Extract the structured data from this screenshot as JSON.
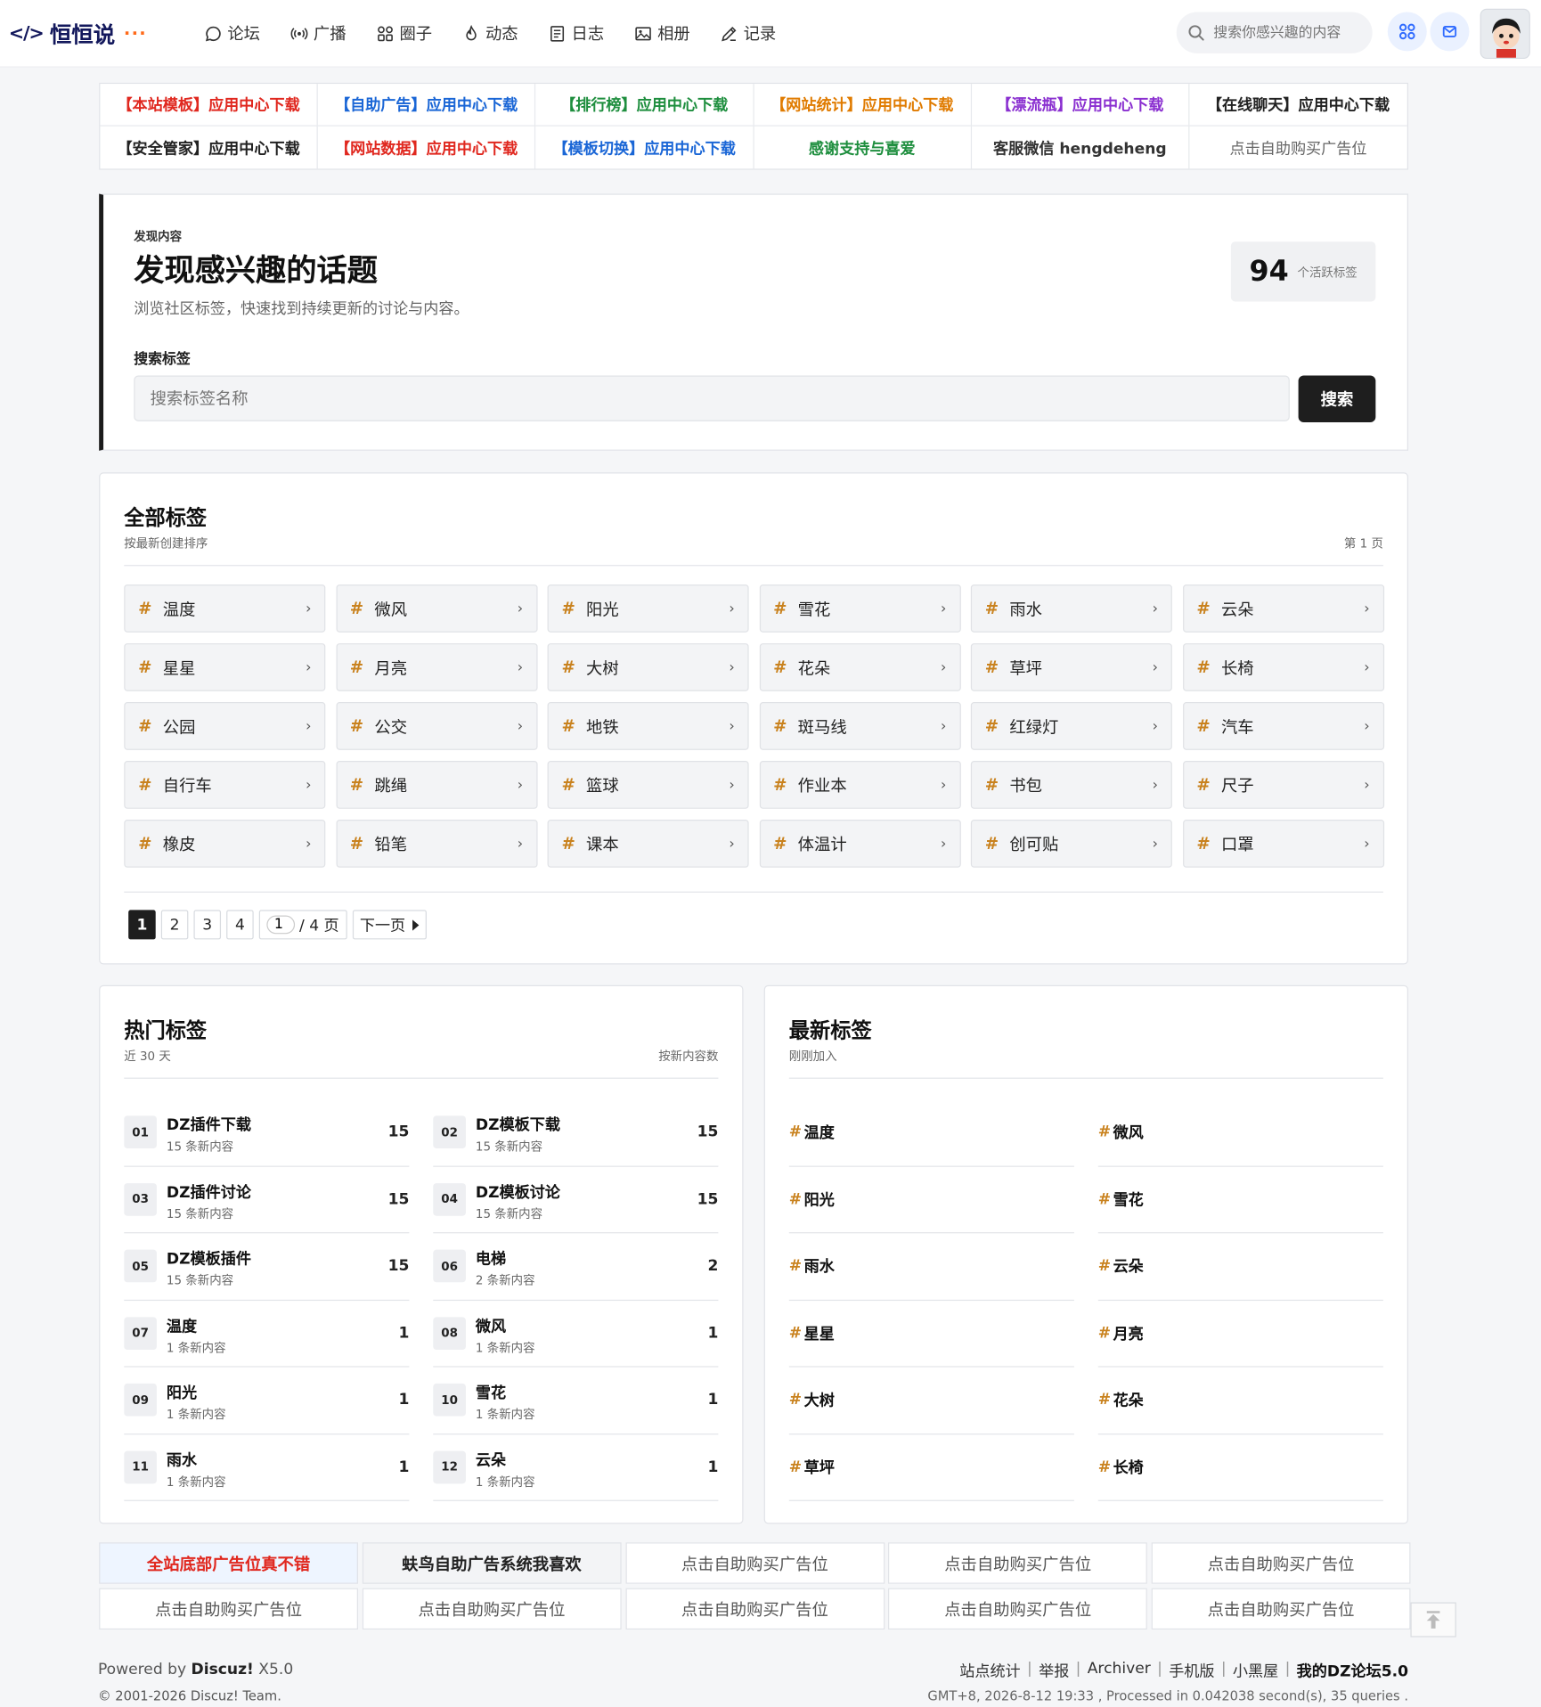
{
  "header": {
    "logo_text": "恒恒说",
    "logo_code": "</>",
    "logo_dots": "···",
    "nav": [
      {
        "label": "论坛",
        "icon": "chat-bubble-icon"
      },
      {
        "label": "广播",
        "icon": "broadcast-icon"
      },
      {
        "label": "圈子",
        "icon": "grid-icon"
      },
      {
        "label": "动态",
        "icon": "flame-icon"
      },
      {
        "label": "日志",
        "icon": "document-icon"
      },
      {
        "label": "相册",
        "icon": "image-icon"
      },
      {
        "label": "记录",
        "icon": "pen-icon"
      }
    ],
    "search_placeholder": "搜索你感兴趣的内容"
  },
  "top_ads": [
    {
      "text": "【本站模板】应用中心下载",
      "color": "#e0281f"
    },
    {
      "text": "【自助广告】应用中心下载",
      "color": "#1a66d6"
    },
    {
      "text": "【排行榜】应用中心下载",
      "color": "#1e8e3e"
    },
    {
      "text": "【网站统计】应用中心下载",
      "color": "#e07b00"
    },
    {
      "text": "【漂流瓶】应用中心下载",
      "color": "#8a2fd0"
    },
    {
      "text": "【在线聊天】应用中心下载",
      "color": "#222222"
    },
    {
      "text": "【安全管家】应用中心下载",
      "color": "#222222"
    },
    {
      "text": "【网站数据】应用中心下载",
      "color": "#e0281f"
    },
    {
      "text": "【模板切换】应用中心下载",
      "color": "#1a66d6"
    },
    {
      "text": "感谢支持与喜爱",
      "color": "#1e8e3e"
    },
    {
      "text": "客服微信 hengdeheng",
      "color": "#333333"
    },
    {
      "text": "点击自助购买广告位",
      "color": "#666666",
      "weight": "normal"
    }
  ],
  "discover": {
    "eyebrow": "发现内容",
    "title": "发现感兴趣的话题",
    "desc": "浏览社区标签，快速找到持续更新的讨论与内容。",
    "stat_num": "94",
    "stat_label": "个活跃标签",
    "search_label": "搜索标签",
    "search_placeholder": "搜索标签名称",
    "search_button": "搜索"
  },
  "all_tags": {
    "title": "全部标签",
    "subtitle": "按最新创建排序",
    "page_label": "第 1 页",
    "hash": "#",
    "chevron": "›",
    "tags": [
      "温度",
      "微风",
      "阳光",
      "雪花",
      "雨水",
      "云朵",
      "星星",
      "月亮",
      "大树",
      "花朵",
      "草坪",
      "长椅",
      "公园",
      "公交",
      "地铁",
      "斑马线",
      "红绿灯",
      "汽车",
      "自行车",
      "跳绳",
      "篮球",
      "作业本",
      "书包",
      "尺子",
      "橡皮",
      "铅笔",
      "课本",
      "体温计",
      "创可贴",
      "口罩"
    ],
    "pager": {
      "pages": [
        "1",
        "2",
        "3",
        "4"
      ],
      "input_value": "1",
      "total": "/ 4 页",
      "next": "下一页"
    }
  },
  "hot_tags": {
    "title": "热门标签",
    "subtitle": "近 30 天",
    "right": "按新内容数",
    "items": [
      {
        "rank": "01",
        "name": "DZ插件下载",
        "count": "15 条新内容",
        "value": "15"
      },
      {
        "rank": "02",
        "name": "DZ模板下载",
        "count": "15 条新内容",
        "value": "15"
      },
      {
        "rank": "03",
        "name": "DZ插件讨论",
        "count": "15 条新内容",
        "value": "15"
      },
      {
        "rank": "04",
        "name": "DZ模板讨论",
        "count": "15 条新内容",
        "value": "15"
      },
      {
        "rank": "05",
        "name": "DZ模板插件",
        "count": "15 条新内容",
        "value": "15"
      },
      {
        "rank": "06",
        "name": "电梯",
        "count": "2 条新内容",
        "value": "2"
      },
      {
        "rank": "07",
        "name": "温度",
        "count": "1 条新内容",
        "value": "1"
      },
      {
        "rank": "08",
        "name": "微风",
        "count": "1 条新内容",
        "value": "1"
      },
      {
        "rank": "09",
        "name": "阳光",
        "count": "1 条新内容",
        "value": "1"
      },
      {
        "rank": "10",
        "name": "雪花",
        "count": "1 条新内容",
        "value": "1"
      },
      {
        "rank": "11",
        "name": "雨水",
        "count": "1 条新内容",
        "value": "1"
      },
      {
        "rank": "12",
        "name": "云朵",
        "count": "1 条新内容",
        "value": "1"
      }
    ]
  },
  "new_tags": {
    "title": "最新标签",
    "subtitle": "刚刚加入",
    "items": [
      "温度",
      "微风",
      "阳光",
      "雪花",
      "雨水",
      "云朵",
      "星星",
      "月亮",
      "大树",
      "花朵",
      "草坪",
      "长椅"
    ]
  },
  "bottom_ads": [
    {
      "text": "全站底部广告位真不错",
      "color": "#e0281f",
      "bg": "#eef5ff",
      "weight": "bold"
    },
    {
      "text": "蚨鸟自助广告系统我喜欢",
      "color": "#222222",
      "bg": "#f3f4f6",
      "weight": "bold"
    },
    {
      "text": "点击自助购买广告位",
      "color": "#555555",
      "bg": "#ffffff",
      "weight": "normal"
    },
    {
      "text": "点击自助购买广告位",
      "color": "#555555",
      "bg": "#ffffff",
      "weight": "normal"
    },
    {
      "text": "点击自助购买广告位",
      "color": "#555555",
      "bg": "#ffffff",
      "weight": "normal"
    },
    {
      "text": "点击自助购买广告位",
      "color": "#555555",
      "bg": "#ffffff",
      "weight": "normal"
    },
    {
      "text": "点击自助购买广告位",
      "color": "#555555",
      "bg": "#ffffff",
      "weight": "normal"
    },
    {
      "text": "点击自助购买广告位",
      "color": "#555555",
      "bg": "#ffffff",
      "weight": "normal"
    },
    {
      "text": "点击自助购买广告位",
      "color": "#555555",
      "bg": "#ffffff",
      "weight": "normal"
    },
    {
      "text": "点击自助购买广告位",
      "color": "#555555",
      "bg": "#ffffff",
      "weight": "normal"
    }
  ],
  "footer": {
    "powered_prefix": "Powered by ",
    "powered_brand": "Discuz!",
    "powered_version": " X5.0",
    "copyright": "© 2001-2026 Discuz! Team.",
    "links": [
      "站点统计",
      "举报",
      "Archiver",
      "手机版",
      "小黑屋"
    ],
    "site_name": "我的DZ论坛5.0",
    "separator": "|",
    "stats": "GMT+8, 2026-8-12 19:33 , Processed in 0.042038 second(s), 35 queries ."
  }
}
